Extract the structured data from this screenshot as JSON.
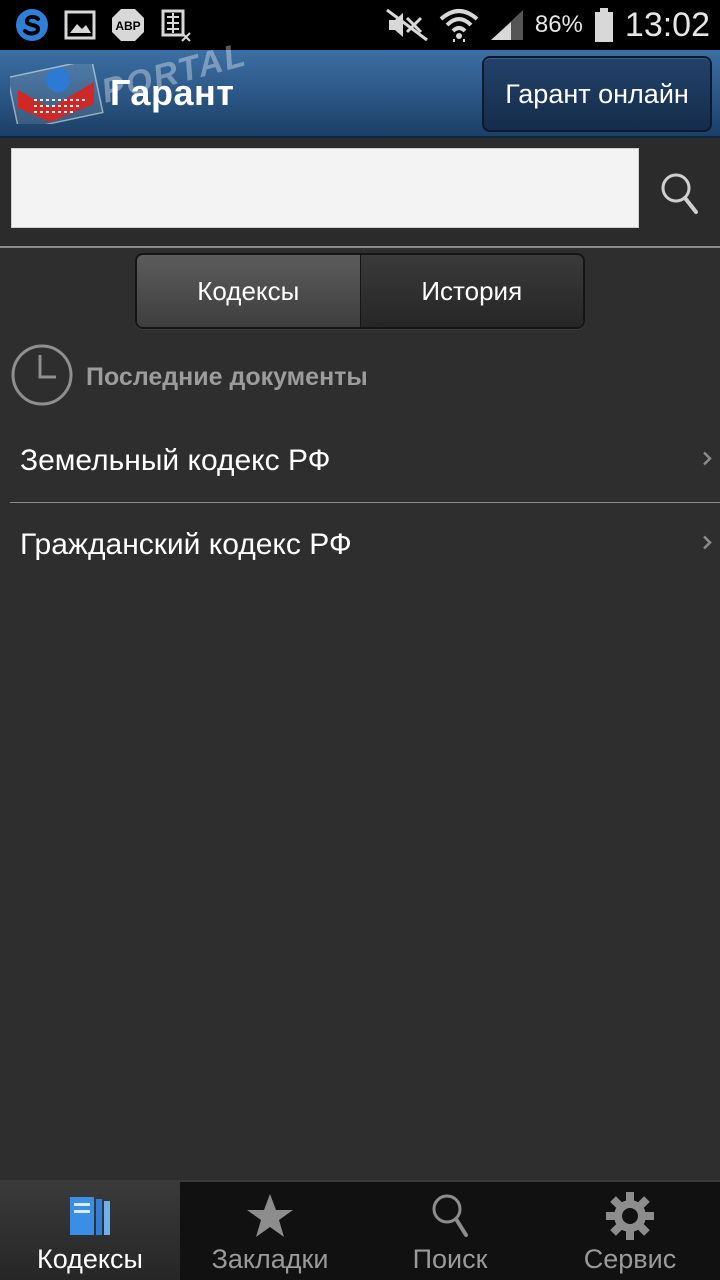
{
  "status_bar": {
    "battery": "86%",
    "time": "13:02",
    "icons": [
      "skype-icon",
      "gallery-icon",
      "adblock-icon",
      "keyboard-icon",
      "mute-icon",
      "wifi-icon",
      "signal-icon",
      "battery-icon"
    ],
    "adblock_text": "ABP"
  },
  "header": {
    "title": "Гарант",
    "online_button": "Гарант онлайн",
    "watermark": "PORTAL"
  },
  "search": {
    "value": "",
    "placeholder": ""
  },
  "segments": {
    "codes": "Кодексы",
    "history": "История"
  },
  "recent": {
    "title": "Последние документы",
    "items": [
      {
        "label": "Земельный кодекс РФ"
      },
      {
        "label": "Гражданский кодекс РФ"
      }
    ]
  },
  "bottom_nav": {
    "items": [
      {
        "label": "Кодексы",
        "icon": "books-icon",
        "active": true
      },
      {
        "label": "Закладки",
        "icon": "star-icon",
        "active": false
      },
      {
        "label": "Поиск",
        "icon": "search-icon",
        "active": false
      },
      {
        "label": "Сервис",
        "icon": "gear-icon",
        "active": false
      }
    ]
  },
  "colors": {
    "header_blue": "#2d5a8a",
    "background": "#2e2e2e",
    "accent_blue": "#3a8ee6"
  }
}
